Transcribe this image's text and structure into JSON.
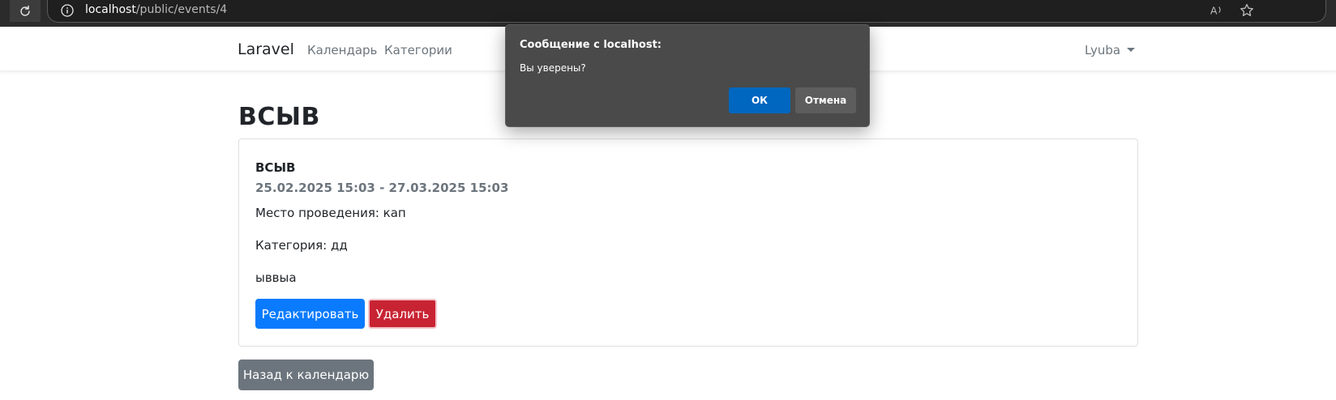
{
  "browser": {
    "url_host": "localhost",
    "url_path": "/public/events/4"
  },
  "navbar": {
    "brand": "Laravel",
    "links": [
      "Календарь",
      "Категории"
    ],
    "user": "Lyuba"
  },
  "event": {
    "page_title": "ВСЫВ",
    "card_title": "ВСЫВ",
    "dates": "25.02.2025 15:03 - 27.03.2025 15:03",
    "place": "Место проведения: кап",
    "category": "Категория: дд",
    "description": "ыввыа",
    "edit_label": "Редактировать",
    "delete_label": "Удалить",
    "back_label": "Назад к календарю"
  },
  "dialog": {
    "title": "Сообщение с localhost:",
    "message": "Вы уверены?",
    "ok_label": "ОК",
    "cancel_label": "Отмена"
  },
  "colors": {
    "primary": "#0a7bfe",
    "danger": "#c82333",
    "secondary": "#6c757d",
    "dialog_ok": "#0067c0"
  }
}
